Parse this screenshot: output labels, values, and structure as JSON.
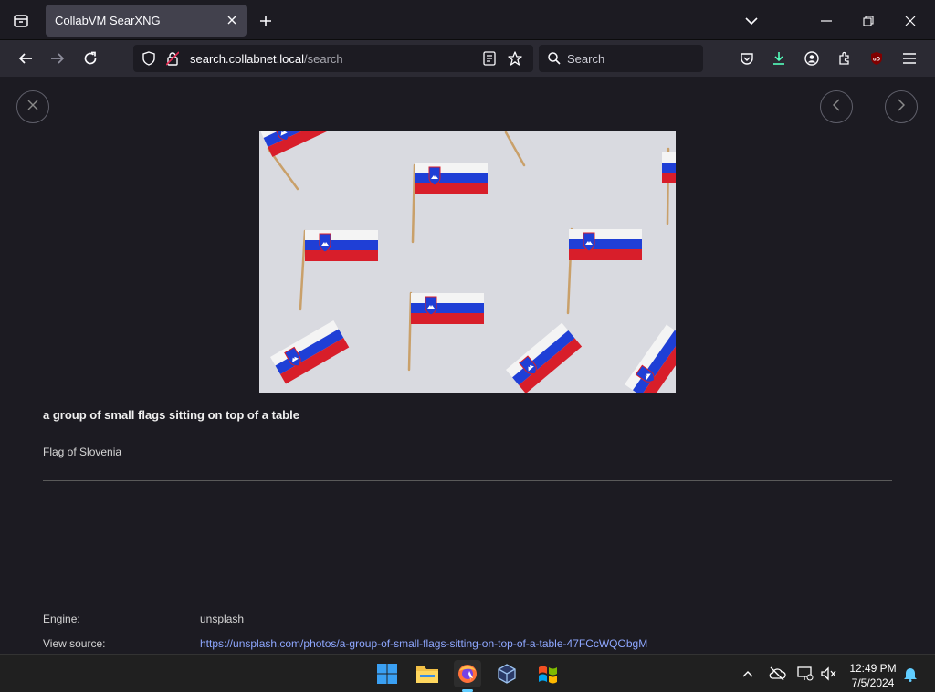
{
  "browser": {
    "tab_title": "CollabVM SearXNG",
    "url_host": "search.collabnet.local",
    "url_path": "/search",
    "search_placeholder": "Search"
  },
  "viewer": {
    "image_title": "a group of small flags sitting on top of a table",
    "image_subtitle": "Flag of Slovenia",
    "engine_label": "Engine:",
    "engine_value": "unsplash",
    "source_label": "View source:",
    "source_url": "https://unsplash.com/photos/a-group-of-small-flags-sitting-on-top-of-a-table-47FCcWQObgM"
  },
  "taskbar": {
    "time": "12:49 PM",
    "date": "7/5/2024"
  },
  "colors": {
    "accent_download": "#54ffbd",
    "link": "#8ea7ff",
    "ublock": "#800000"
  }
}
